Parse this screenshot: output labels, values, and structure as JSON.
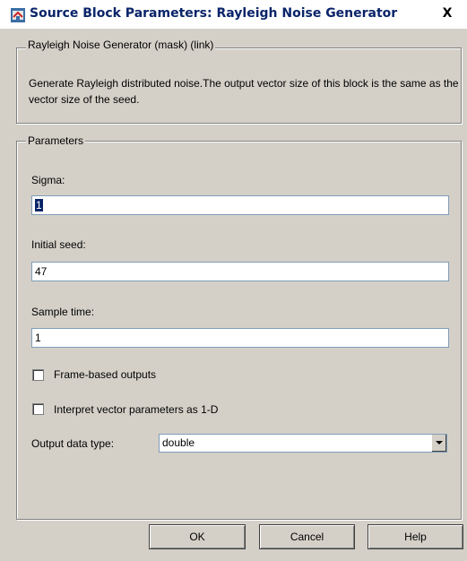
{
  "window": {
    "title": "Source Block Parameters: Rayleigh Noise Generator",
    "close_glyph": "X"
  },
  "description_group": {
    "legend": "Rayleigh Noise Generator (mask) (link)",
    "text": "Generate Rayleigh distributed noise.The output vector size of this block is the same as the vector size of the seed."
  },
  "parameters_group": {
    "legend": "Parameters",
    "sigma": {
      "label": "Sigma:",
      "value": "1"
    },
    "initial_seed": {
      "label": "Initial seed:",
      "value": "47"
    },
    "sample_time": {
      "label": "Sample time:",
      "value": "1"
    },
    "frame_based": {
      "label": "Frame-based outputs",
      "checked": false
    },
    "interpret_1d": {
      "label": "Interpret vector parameters as 1-D",
      "checked": false
    },
    "output_data_type": {
      "label": "Output data type:",
      "value": "double"
    }
  },
  "buttons": {
    "ok": "OK",
    "cancel": "Cancel",
    "help": "Help"
  },
  "icons": {
    "window_icon": "simulink-block-icon",
    "dropdown": "chevron-down-icon"
  }
}
